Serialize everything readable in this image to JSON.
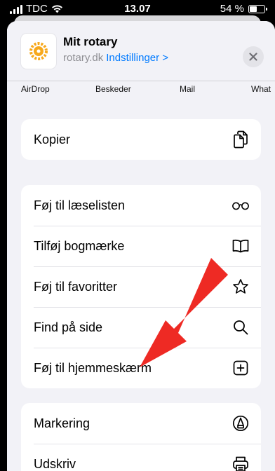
{
  "status_bar": {
    "carrier": "TDC",
    "time": "13.07",
    "battery": "54 %",
    "battery_level": 0.54
  },
  "header": {
    "title": "Mit rotary",
    "domain": "rotary.dk",
    "settings_link": "Indstillinger >"
  },
  "share_targets": [
    "AirDrop",
    "Beskeder",
    "Mail",
    "What"
  ],
  "actions_group1": [
    {
      "label": "Kopier",
      "icon": "copy-icon"
    }
  ],
  "actions_group2": [
    {
      "label": "Føj til læselisten",
      "icon": "reading-glasses-icon"
    },
    {
      "label": "Tilføj bogmærke",
      "icon": "book-icon"
    },
    {
      "label": "Føj til favoritter",
      "icon": "star-icon"
    },
    {
      "label": "Find på side",
      "icon": "search-icon"
    },
    {
      "label": "Føj til hjemmeskærm",
      "icon": "add-square-icon"
    }
  ],
  "actions_group3": [
    {
      "label": "Markering",
      "icon": "markup-pen-icon"
    },
    {
      "label": "Udskriv",
      "icon": "printer-icon"
    }
  ],
  "annotation": {
    "arrow_color": "#ee2a24"
  },
  "colors": {
    "link": "#007aff",
    "rotary_gold": "#f7a81b"
  }
}
